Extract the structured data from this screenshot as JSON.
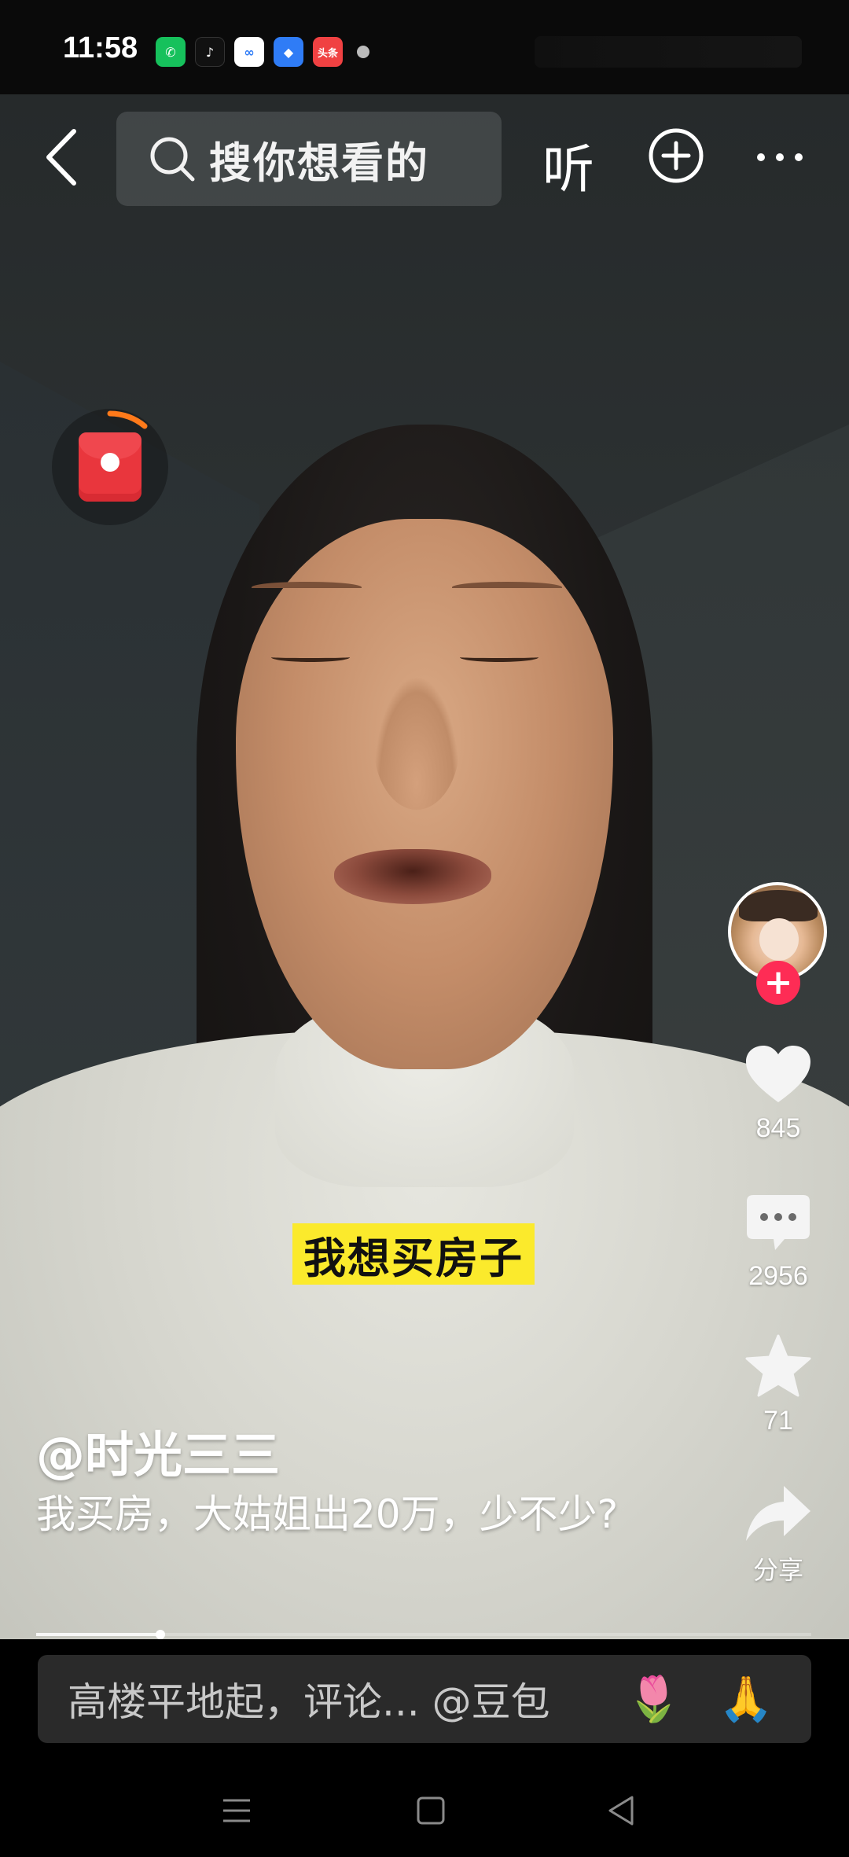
{
  "status_bar": {
    "time": "11:58",
    "apps": [
      {
        "name": "wechat-icon",
        "glyph": "✆"
      },
      {
        "name": "tiktok-icon",
        "glyph": "♪"
      },
      {
        "name": "cloud-app-icon",
        "glyph": "∞"
      },
      {
        "name": "feishu-icon",
        "glyph": "◆"
      },
      {
        "name": "toutiao-icon",
        "glyph": "头条"
      }
    ]
  },
  "top_nav": {
    "search_placeholder": "搜你想看的",
    "listen_label": "听"
  },
  "video": {
    "subtitle": "我想买房子",
    "author": "@时光三三",
    "caption": "我买房，大姑姐出20万，少不少?",
    "progress_fraction": 0.16
  },
  "right_rail": {
    "likes": "845",
    "comments": "2956",
    "favorites": "71",
    "share_label": "分享"
  },
  "comment_bar": {
    "placeholder": "高楼平地起，评论... @豆包",
    "emoji_1": "🌷",
    "emoji_2": "🙏"
  },
  "colors": {
    "accent_red": "#fe2c55",
    "subtitle_yellow": "#fbea2c"
  }
}
